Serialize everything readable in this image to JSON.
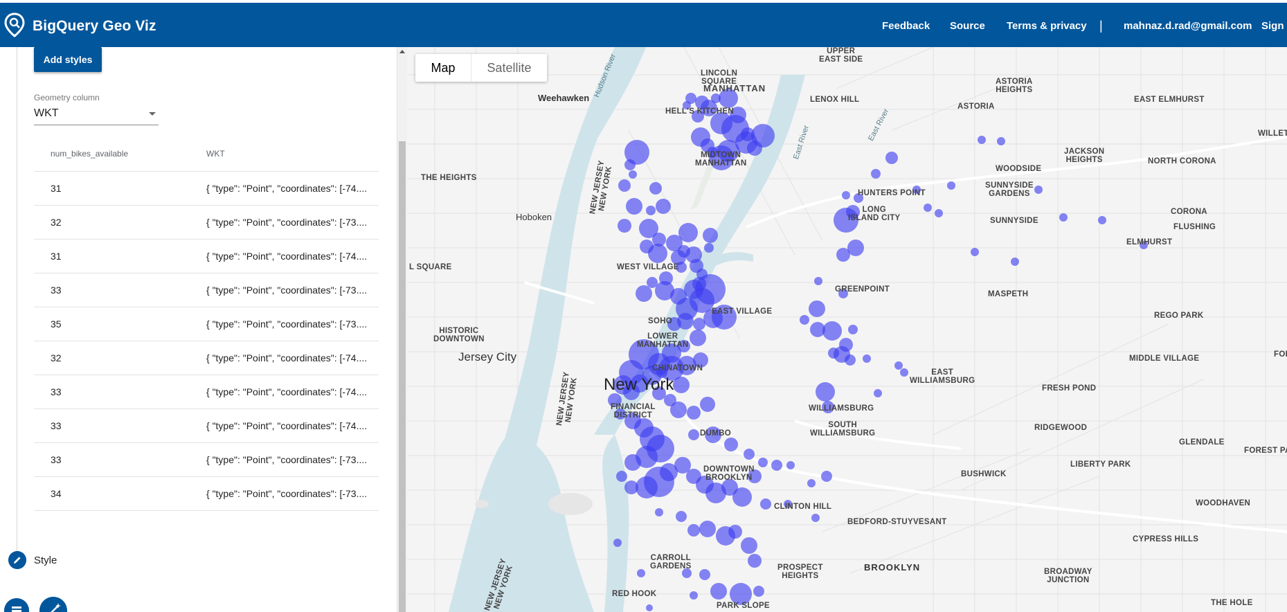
{
  "header": {
    "title": "BigQuery Geo Viz",
    "nav": {
      "feedback": "Feedback",
      "source": "Source",
      "terms": "Terms & privacy",
      "separator": "|",
      "user": "mahnaz.d.rad@gmail.com",
      "signout": "Sign o"
    },
    "colors": {
      "bar": "#02569b",
      "text": "#ffffff"
    },
    "icon": "map-pin-search-icon"
  },
  "sidebar": {
    "add_styles_label": "Add styles",
    "geometry": {
      "label": "Geometry column",
      "value": "WKT"
    },
    "table": {
      "columns": [
        "num_bikes_available",
        "WKT"
      ],
      "rows": [
        [
          "31",
          "{ \"type\": \"Point\", \"coordinates\": [-74...."
        ],
        [
          "32",
          "{ \"type\": \"Point\", \"coordinates\": [-73...."
        ],
        [
          "31",
          "{ \"type\": \"Point\", \"coordinates\": [-74...."
        ],
        [
          "33",
          "{ \"type\": \"Point\", \"coordinates\": [-73...."
        ],
        [
          "35",
          "{ \"type\": \"Point\", \"coordinates\": [-73...."
        ],
        [
          "32",
          "{ \"type\": \"Point\", \"coordinates\": [-74...."
        ],
        [
          "33",
          "{ \"type\": \"Point\", \"coordinates\": [-74...."
        ],
        [
          "33",
          "{ \"type\": \"Point\", \"coordinates\": [-74...."
        ],
        [
          "33",
          "{ \"type\": \"Point\", \"coordinates\": [-73...."
        ],
        [
          "34",
          "{ \"type\": \"Point\", \"coordinates\": [-73...."
        ]
      ]
    },
    "style_step_label": "Style",
    "icons": [
      "pencil-icon",
      "list-icon",
      "magic-wand-icon"
    ]
  },
  "map": {
    "type_control": {
      "map": "Map",
      "satellite": "Satellite",
      "selected": "Map"
    },
    "marker_color": "#3b3bf0",
    "water_color": "#cfe3ea",
    "labels": {
      "new_york": "New York",
      "jersey_city": "Jersey City",
      "manhattan": "MANHATTAN",
      "brooklyn": "BROOKLYN",
      "hoboken": "Hoboken",
      "weehawken": "Weehawken",
      "lincoln_square": "LINCOLN\nSQUARE",
      "upper_east_side": "UPPER\nEAST SIDE",
      "lenox_hill": "LENOX HILL",
      "hells_kitchen": "HELL'S KITCHEN",
      "midtown": "MIDTOWN\nMANHATTAN",
      "west_village": "WEST VILLAGE",
      "east_village": "EAST VILLAGE",
      "soho": "SOHO",
      "lower_manhattan": "LOWER\nMANHATTAN",
      "chinatown": "CHINATOWN",
      "financial_district": "FINANCIAL\nDISTRICT",
      "dumbo": "DUMBO",
      "downtown_brooklyn": "DOWNTOWN\nBROOKLYN",
      "clinton_hill": "CLINTON HILL",
      "carroll_gardens": "CARROLL\nGARDENS",
      "red_hook": "RED HOOK",
      "park_slope": "PARK SLOPE",
      "prospect_heights": "PROSPECT\nHEIGHTS",
      "bedford_stuyvesant": "BEDFORD-STUYVESANT",
      "williamsburg": "WILLIAMSBURG",
      "south_williamsburg": "SOUTH\nWILLIAMSBURG",
      "east_williamsburg": "EAST\nWILLIAMSBURG",
      "greenpoint": "GREENPOINT",
      "hunters_point": "HUNTERS POINT",
      "long_island_city": "LONG\nISLAND CITY",
      "astoria": "ASTORIA",
      "astoria_heights": "ASTORIA\nHEIGHTS",
      "east_elmhurst": "EAST ELMHURST",
      "jackson_heights": "JACKSON\nHEIGHTS",
      "north_corona": "NORTH CORONA",
      "woodside": "WOODSIDE",
      "sunnyside_gardens": "SUNNYSIDE\nGARDENS",
      "sunnyside": "SUNNYSIDE",
      "corona": "CORONA",
      "flushing": "FLUSHING",
      "elmhurst": "ELMHURST",
      "maspeth": "MASPETH",
      "rego_park": "REGO PARK",
      "middle_village": "MIDDLE VILLAGE",
      "fresh_pond": "FRESH POND",
      "ridgewood": "RIDGEWOOD",
      "glendale": "GLENDALE",
      "bushwick": "BUSHWICK",
      "liberty_park": "LIBERTY PARK",
      "forest_park": "FOREST PARK",
      "woodhaven": "WOODHAVEN",
      "cypress_hills": "CYPRESS HILLS",
      "broadway_junction": "BROADWAY\nJUNCTION",
      "the_hole": "THE HOLE",
      "the_heights": "THE HEIGHTS",
      "historic_downtown": "HISTORIC\nDOWNTOWN",
      "l_square": "L SQUARE",
      "willet": "WILLET",
      "fores": "FORES",
      "hudson_river": "Hudson River",
      "east_river": "East River",
      "east_river_2": "East River",
      "nj_ny_1": "NEW JERSEY\nNEW YORK",
      "nj_ny_2": "NEW JERSEY\nNEW YORK",
      "nj_ny_3": "NEW JERSEY\nNEW YORK"
    }
  }
}
